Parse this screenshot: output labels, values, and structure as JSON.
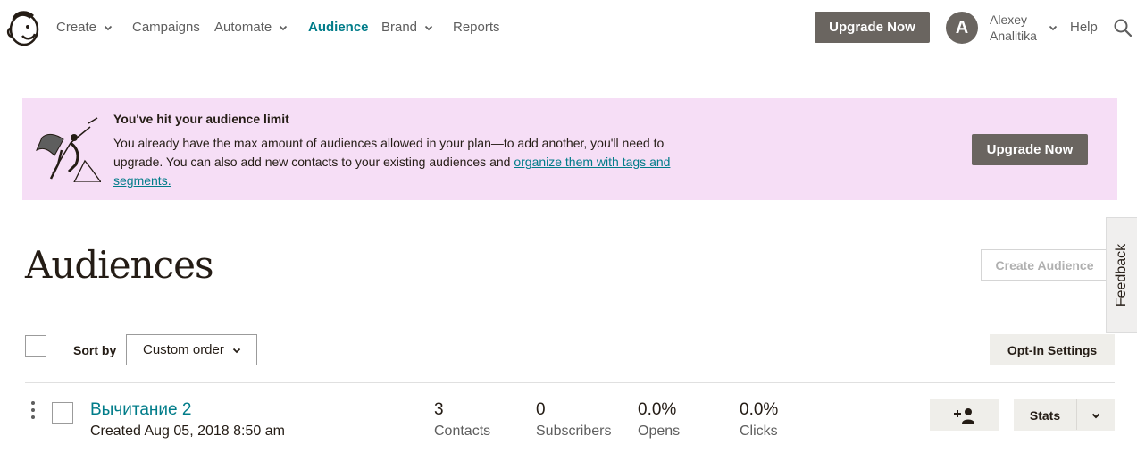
{
  "nav": {
    "items": [
      "Create",
      "Campaigns",
      "Automate",
      "Audience",
      "Brand",
      "Reports"
    ],
    "upgrade_label": "Upgrade Now",
    "avatar_initial": "A",
    "user_first": "Alexey",
    "user_last": "Analitika",
    "help_label": "Help",
    "active_color": "#007c89"
  },
  "banner": {
    "title": "You've hit your audience limit",
    "text_before_link": "You already have the max amount of audiences allowed in your plan—to add another, you'll need to upgrade. You can also add new contacts to your existing audiences and ",
    "link_text": "organize them with tags and segments.",
    "button_label": "Upgrade Now",
    "background": "#f6def6"
  },
  "page": {
    "title": "Audiences",
    "create_button": "Create Audience",
    "feedback_label": "Feedback"
  },
  "toolbar": {
    "sort_label": "Sort by",
    "sort_value": "Custom order",
    "optin_label": "Opt-In Settings"
  },
  "lists": [
    {
      "name": "Вычитание 2",
      "created": "Created Aug 05, 2018 8:50 am",
      "stats": [
        {
          "value": "3",
          "label": "Contacts"
        },
        {
          "value": "0",
          "label": "Subscribers"
        },
        {
          "value": "0.0%",
          "label": "Opens"
        },
        {
          "value": "0.0%",
          "label": "Clicks"
        }
      ],
      "stats_button": "Stats"
    }
  ],
  "icons": {
    "logo": "mailchimp-freddie-logo",
    "search": "search-icon",
    "add_contact": "add-user-icon",
    "kebab": "kebab-menu-icon",
    "chevron": "chevron-down-icon"
  }
}
